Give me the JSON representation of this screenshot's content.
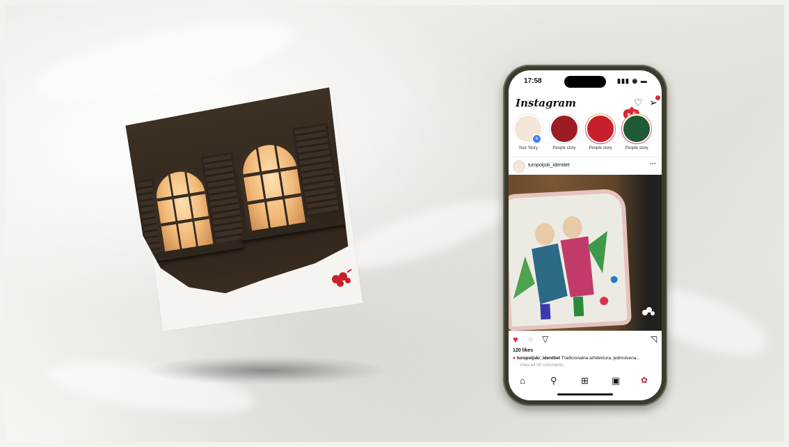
{
  "phone": {
    "status_time": "17:58",
    "status_icons": "▮▮▮ ◉ ▬",
    "app_title": "Instagram",
    "notification_count": "8",
    "stories": [
      {
        "label": "Your Story",
        "color": "#f3e6d8"
      },
      {
        "label": "People story",
        "color": "#9b1c22"
      },
      {
        "label": "People story",
        "color": "#c8202b"
      },
      {
        "label": "People story",
        "color": "#1f5a35"
      }
    ],
    "post": {
      "username": "turopoljski_identitet",
      "likes": "120 likes",
      "caption_user": "turopoljski_identitet",
      "caption_text": "Tradicionalna arhitektura, jedinstvena...",
      "view_comments": "View all 50 comments"
    },
    "icons": {
      "heart": "heart-icon",
      "dm": "send-icon",
      "like": "like-icon",
      "comment": "comment-icon",
      "share": "share-icon",
      "bookmark": "bookmark-icon",
      "home": "home-icon",
      "search": "search-icon",
      "create": "plus-square-icon",
      "reels": "reels-icon",
      "profile": "profile-avatar-icon"
    }
  },
  "colors": {
    "accent_red": "#e0243a",
    "like_red": "#e0243a",
    "phone_frame": "#3a3a2e"
  }
}
